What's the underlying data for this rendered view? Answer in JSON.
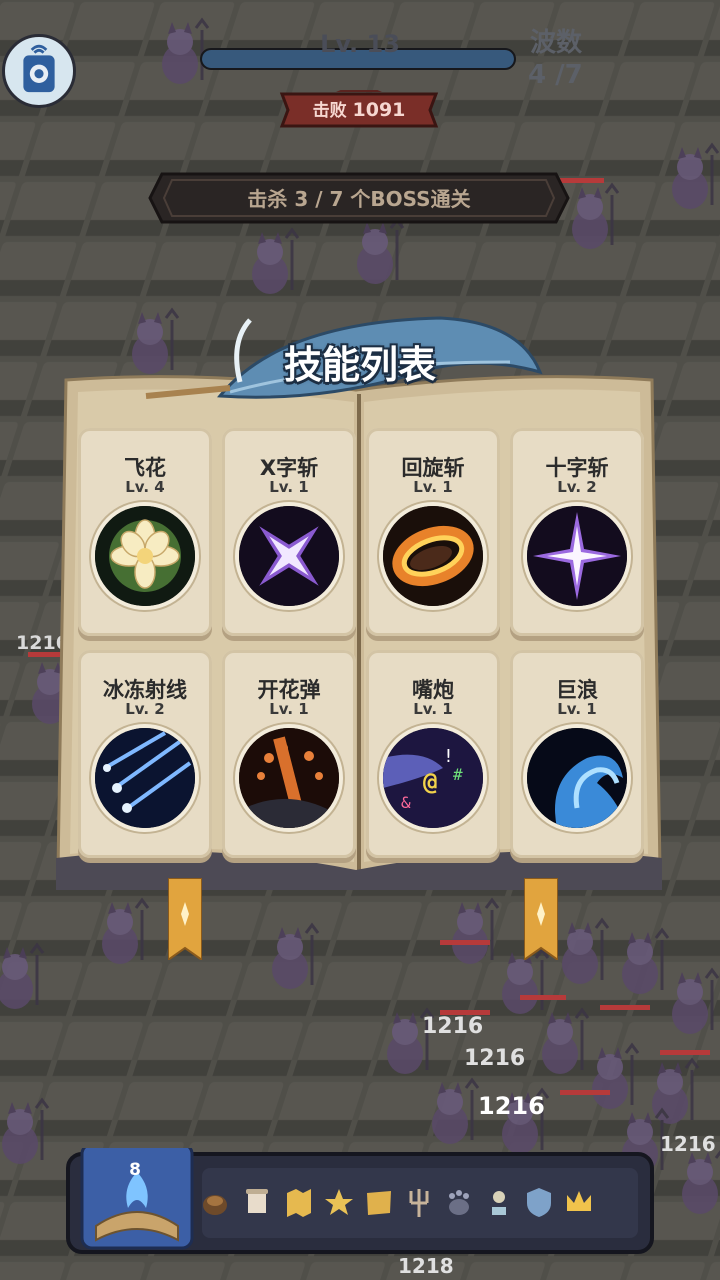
{
  "hud": {
    "level": "Lv. 13",
    "xp_fraction": 1.0,
    "kill_label": "击败",
    "kill_count": "1091",
    "wave_label": "波数",
    "wave_value": "4 /7",
    "objective": "击杀 3 / 7 个BOSS通关"
  },
  "damage_numbers": [
    "1216",
    "1216",
    "1216",
    "1216",
    "1216",
    "1218"
  ],
  "panel": {
    "title": "技能列表",
    "skills": [
      {
        "name": "飞花",
        "level": "Lv. 4",
        "icon": "flower-icon"
      },
      {
        "name": "X字斩",
        "level": "Lv. 1",
        "icon": "x-slash-icon"
      },
      {
        "name": "回旋斩",
        "level": "Lv. 1",
        "icon": "spin-slash-icon"
      },
      {
        "name": "十字斩",
        "level": "Lv. 2",
        "icon": "cross-slash-icon"
      },
      {
        "name": "冰冻射线",
        "level": "Lv. 2",
        "icon": "ice-ray-icon"
      },
      {
        "name": "开花弹",
        "level": "Lv. 1",
        "icon": "bloom-shell-icon"
      },
      {
        "name": "嘴炮",
        "level": "Lv. 1",
        "icon": "mouth-cannon-icon"
      },
      {
        "name": "巨浪",
        "level": "Lv. 1",
        "icon": "giant-wave-icon"
      }
    ]
  },
  "bottom": {
    "book_count": "8",
    "items": [
      "chestnut-icon",
      "scroll-icon",
      "map-icon",
      "star-icon",
      "map-scroll-icon",
      "trident-icon",
      "paw-icon",
      "gem-stand-icon",
      "shield-icon",
      "crown-icon"
    ]
  },
  "colors": {
    "card": "#e7dcc5",
    "book": "#d8c9a8",
    "title_outline": "#1d2f44",
    "xp": "#37597c",
    "kill_badge": "#7a2e28"
  }
}
